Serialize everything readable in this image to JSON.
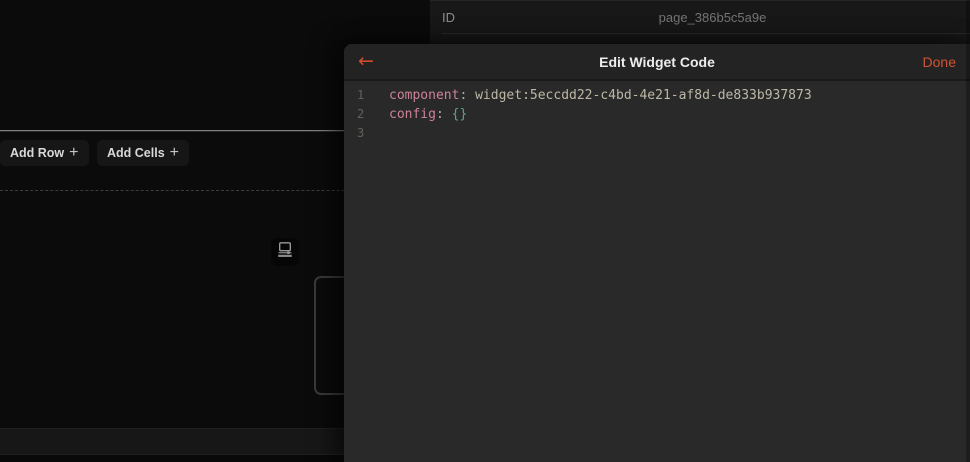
{
  "accent_color": "#d04f2e",
  "underlying_page": {
    "properties_panel": {
      "id_label": "ID",
      "id_value": "page_386b5c5a9e"
    },
    "toolbar": {
      "add_row": "Add Row",
      "add_cells": "Add Cells",
      "plus": "+"
    }
  },
  "modal": {
    "title": "Edit Widget Code",
    "back_glyph": "←",
    "done": "Done",
    "editor": {
      "language_colors": {
        "key": "#cc8297",
        "punctuation": "#b0aca3",
        "value": "#bdb8a6",
        "brace": "#5fa287",
        "line_number": "#65605a"
      },
      "lines": [
        {
          "number": "1",
          "tokens": [
            {
              "type": "key",
              "text": "component"
            },
            {
              "type": "punctuation",
              "text": ":"
            },
            {
              "type": "value",
              "text": " widget:5eccdd22-c4bd-4e21-af8d-de833b937873"
            }
          ]
        },
        {
          "number": "2",
          "tokens": [
            {
              "type": "key",
              "text": "config"
            },
            {
              "type": "punctuation",
              "text": ":"
            },
            {
              "type": "brace",
              "text": " {}"
            }
          ]
        },
        {
          "number": "3",
          "tokens": []
        }
      ]
    }
  }
}
